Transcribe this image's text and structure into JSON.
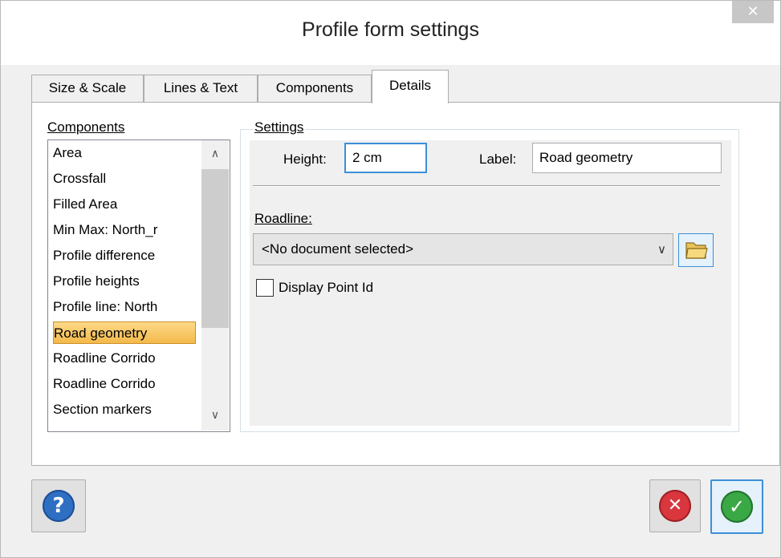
{
  "window": {
    "title": "Profile form settings",
    "close_glyph": "✕"
  },
  "tabs": [
    {
      "label": "Size & Scale"
    },
    {
      "label": "Lines & Text"
    },
    {
      "label": "Components"
    },
    {
      "label": "Details",
      "active": true
    }
  ],
  "components": {
    "label": "Components",
    "items": [
      "Area",
      "Crossfall",
      "Filled Area",
      "Min Max: North_r",
      "Profile difference",
      "Profile heights",
      "Profile line: North",
      "Road geometry",
      "Roadline Corrido",
      "Roadline Corrido",
      "Section markers"
    ],
    "selected": "Road geometry",
    "scroll_up": "∧",
    "scroll_down": "∨"
  },
  "settings": {
    "label": "Settings",
    "height_label": "Height:",
    "height_value": "2 cm",
    "label_label": "Label:",
    "label_value": "Road geometry",
    "roadline_label": "Roadline:",
    "roadline_value": "<No document selected>",
    "dropdown_glyph": "∨",
    "display_point_id_label": "Display Point Id",
    "display_point_id_checked": false
  },
  "footer": {
    "help_glyph": "?",
    "cancel_glyph": "✕",
    "ok_glyph": "✓"
  },
  "colors": {
    "accent": "#3c8fd8",
    "selection": "#f3b94a",
    "help_blue": "#2e6fc4",
    "cancel_red": "#d9363e",
    "ok_green": "#3aa845"
  }
}
